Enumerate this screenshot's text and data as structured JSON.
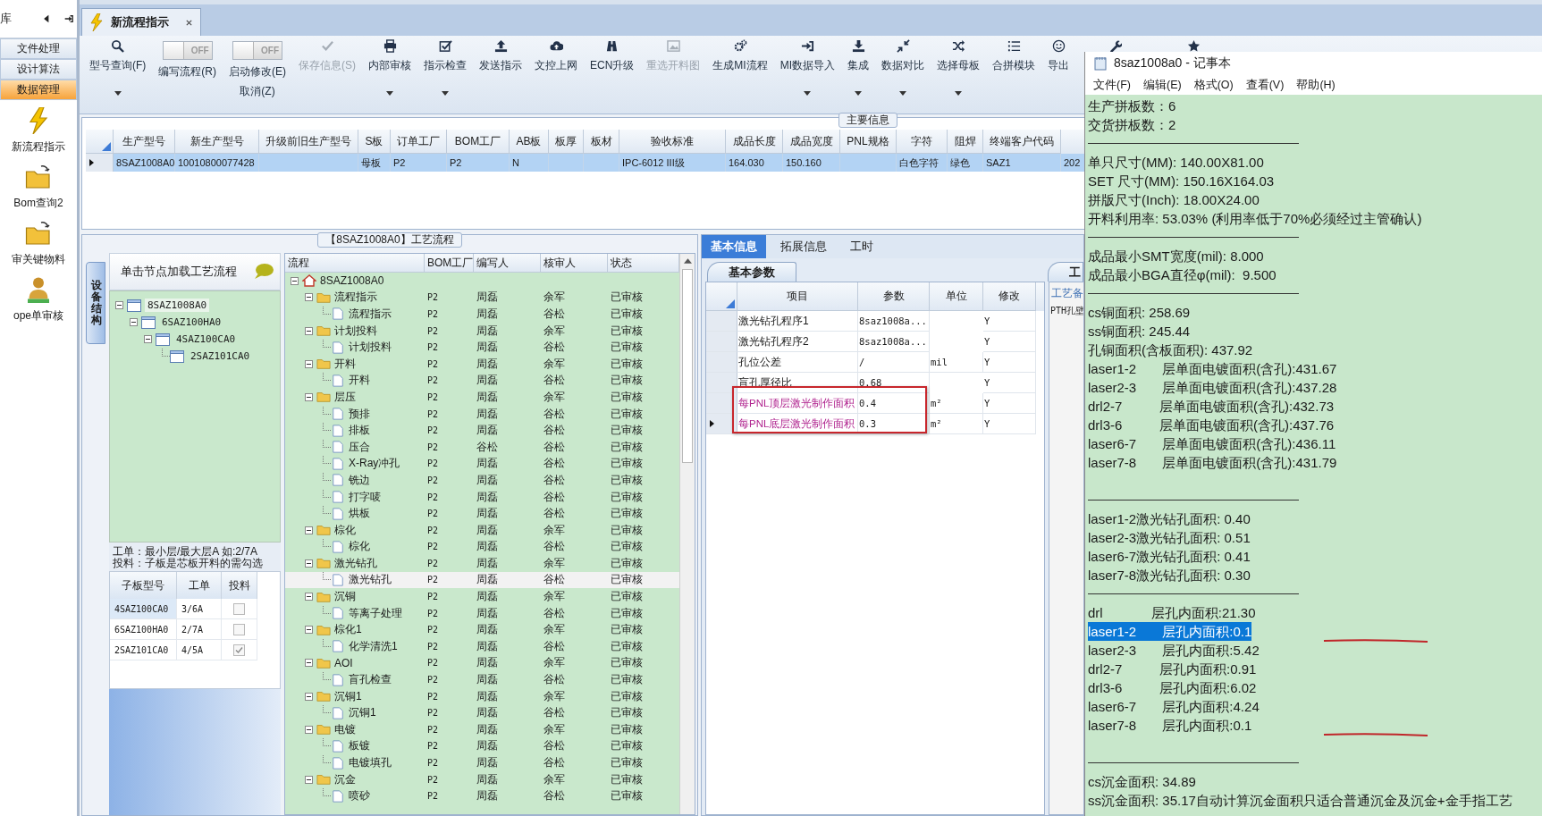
{
  "sidebar": {
    "title": "库",
    "menu": [
      {
        "label": "文件处理",
        "selected": false
      },
      {
        "label": "设计算法",
        "selected": false
      },
      {
        "label": "数据管理",
        "selected": true
      }
    ],
    "shortcuts": [
      {
        "label": "新流程指示"
      },
      {
        "label": "Bom查询2"
      },
      {
        "label": "审关键物料"
      },
      {
        "label": "ope单审核"
      }
    ]
  },
  "tabs": [
    {
      "label": "新流程指示",
      "selected": true,
      "closable": true
    }
  ],
  "toolbar": [
    {
      "kind": "button",
      "label": "型号查询(F)",
      "disabled": false,
      "has_menu": true
    },
    {
      "kind": "toggle",
      "label": "编写流程(R)",
      "switch_text": "OFF",
      "on": false
    },
    {
      "kind": "toggle",
      "label": "启动修改(E)",
      "label2": "取消(Z)",
      "switch_text": "OFF",
      "on": false
    },
    {
      "kind": "button",
      "label": "保存信息(S)",
      "disabled": true,
      "has_menu": false
    },
    {
      "kind": "button",
      "label": "内部审核",
      "disabled": false,
      "has_menu": true
    },
    {
      "kind": "button",
      "label": "指示检查",
      "disabled": false,
      "has_menu": true
    },
    {
      "kind": "button",
      "label": "发送指示",
      "disabled": false,
      "has_menu": false
    },
    {
      "kind": "button",
      "label": "文控上网",
      "disabled": false,
      "has_menu": false
    },
    {
      "kind": "button",
      "label": "ECN升级",
      "disabled": false,
      "has_menu": false
    },
    {
      "kind": "button",
      "label": "重选开料图",
      "disabled": true,
      "has_menu": false
    },
    {
      "kind": "button",
      "label": "生成MI流程",
      "disabled": false,
      "has_menu": false
    },
    {
      "kind": "button",
      "label": "MI数据导入",
      "disabled": false,
      "has_menu": true
    },
    {
      "kind": "button",
      "label": "集成",
      "disabled": false,
      "has_menu": true
    },
    {
      "kind": "button",
      "label": "数据对比",
      "disabled": false,
      "has_menu": true
    },
    {
      "kind": "button",
      "label": "选择母板",
      "disabled": false,
      "has_menu": true
    },
    {
      "kind": "button",
      "label": "合拼模块",
      "disabled": false,
      "has_menu": false
    },
    {
      "kind": "button",
      "label": "导出",
      "disabled": false,
      "has_menu": false
    },
    {
      "kind": "icon"
    },
    {
      "kind": "icon"
    }
  ],
  "main_info": {
    "title": "主要信息",
    "columns": [
      "生产型号",
      "新生产型号",
      "升级前旧生产型号",
      "S板",
      "订单工厂",
      "BOM工厂",
      "AB板",
      "板厚",
      "板材",
      "验收标准",
      "成品长度",
      "成品宽度",
      "PNL规格",
      "字符",
      "阻焊",
      "终端客户代码"
    ],
    "rows": [
      {
        "selected": true,
        "cells": [
          "8SAZ1008A0",
          "10010800077428",
          null,
          "母板",
          "P2",
          "P2",
          "N",
          null,
          null,
          "IPC-6012 III级",
          "164.030",
          "150.160",
          null,
          "白色字符",
          "绿色",
          "SAZ1",
          "202"
        ]
      }
    ]
  },
  "process": {
    "title": "【8SAZ1008A0】工艺流程",
    "side_tab": "设备结构",
    "structure": {
      "hint": "单击节点加载工艺流程",
      "tree": [
        {
          "label": "8SAZ1008A0",
          "expanded": true,
          "children": [
            {
              "label": "6SAZ100HA0",
              "expanded": true,
              "children": [
                {
                  "label": "4SAZ100CA0",
                  "expanded": true,
                  "children": [
                    {
                      "label": "2SAZ101CA0"
                    }
                  ]
                }
              ]
            }
          ]
        }
      ],
      "notes": [
        "工单：最小层/最大层A 如:2/7A",
        "投料：子板是芯板开料的需勾选"
      ],
      "boards": {
        "columns": [
          "子板型号",
          "工单",
          "投料"
        ],
        "rows": [
          {
            "model": "4SAZ100CA0",
            "order": "3/6A",
            "feed": false,
            "selected": true
          },
          {
            "model": "6SAZ100HA0",
            "order": "2/7A",
            "feed": false,
            "selected": false
          },
          {
            "model": "2SAZ101CA0",
            "order": "4/5A",
            "feed": true,
            "selected": false
          }
        ]
      }
    },
    "flow": {
      "columns": [
        "流程",
        "BOM工厂",
        "编写人",
        "核审人",
        "状态"
      ],
      "tree": [
        {
          "name": "8SAZ1008A0",
          "expanded": true,
          "selected": false,
          "children": [
            {
              "name": "流程指示",
              "factory": "P2",
              "writer": "周磊",
              "reviewer": "余军",
              "status": "已审核",
              "expanded": true,
              "selected": false,
              "children": [
                {
                  "name": "流程指示",
                  "factory": "P2",
                  "writer": "周磊",
                  "reviewer": "谷松",
                  "status": "已审核",
                  "selected": false
                }
              ]
            },
            {
              "name": "计划投料",
              "factory": "P2",
              "writer": "周磊",
              "reviewer": "余军",
              "status": "已审核",
              "expanded": true,
              "selected": false,
              "children": [
                {
                  "name": "计划投料",
                  "factory": "P2",
                  "writer": "周磊",
                  "reviewer": "谷松",
                  "status": "已审核",
                  "selected": false
                }
              ]
            },
            {
              "name": "开料",
              "factory": "P2",
              "writer": "周磊",
              "reviewer": "余军",
              "status": "已审核",
              "expanded": true,
              "selected": false,
              "children": [
                {
                  "name": "开料",
                  "factory": "P2",
                  "writer": "周磊",
                  "reviewer": "谷松",
                  "status": "已审核",
                  "selected": false
                }
              ]
            },
            {
              "name": "层压",
              "factory": "P2",
              "writer": "周磊",
              "reviewer": "余军",
              "status": "已审核",
              "expanded": true,
              "selected": false,
              "children": [
                {
                  "name": "预排",
                  "factory": "P2",
                  "writer": "周磊",
                  "reviewer": "谷松",
                  "status": "已审核",
                  "selected": false
                },
                {
                  "name": "排板",
                  "factory": "P2",
                  "writer": "周磊",
                  "reviewer": "谷松",
                  "status": "已审核",
                  "selected": false
                },
                {
                  "name": "压合",
                  "factory": "P2",
                  "writer": "谷松",
                  "reviewer": "谷松",
                  "status": "已审核",
                  "selected": false
                },
                {
                  "name": "X-Ray冲孔",
                  "factory": "P2",
                  "writer": "周磊",
                  "reviewer": "谷松",
                  "status": "已审核",
                  "selected": false
                },
                {
                  "name": "铣边",
                  "factory": "P2",
                  "writer": "周磊",
                  "reviewer": "谷松",
                  "status": "已审核",
                  "selected": false
                },
                {
                  "name": "打字唛",
                  "factory": "P2",
                  "writer": "周磊",
                  "reviewer": "谷松",
                  "status": "已审核",
                  "selected": false
                },
                {
                  "name": "烘板",
                  "factory": "P2",
                  "writer": "周磊",
                  "reviewer": "谷松",
                  "status": "已审核",
                  "selected": false
                }
              ]
            },
            {
              "name": "棕化",
              "factory": "P2",
              "writer": "周磊",
              "reviewer": "余军",
              "status": "已审核",
              "expanded": true,
              "selected": false,
              "children": [
                {
                  "name": "棕化",
                  "factory": "P2",
                  "writer": "周磊",
                  "reviewer": "谷松",
                  "status": "已审核",
                  "selected": false
                }
              ]
            },
            {
              "name": "激光钻孔",
              "factory": "P2",
              "writer": "周磊",
              "reviewer": "余军",
              "status": "已审核",
              "expanded": true,
              "selected": false,
              "children": [
                {
                  "name": "激光钻孔",
                  "factory": "P2",
                  "writer": "周磊",
                  "reviewer": "谷松",
                  "status": "已审核",
                  "selected": true
                }
              ]
            },
            {
              "name": "沉铜",
              "factory": "P2",
              "writer": "周磊",
              "reviewer": "余军",
              "status": "已审核",
              "expanded": true,
              "selected": false,
              "children": [
                {
                  "name": "等离子处理",
                  "factory": "P2",
                  "writer": "周磊",
                  "reviewer": "谷松",
                  "status": "已审核",
                  "selected": false
                }
              ]
            },
            {
              "name": "棕化1",
              "factory": "P2",
              "writer": "周磊",
              "reviewer": "余军",
              "status": "已审核",
              "expanded": true,
              "selected": false,
              "children": [
                {
                  "name": "化学清洗1",
                  "factory": "P2",
                  "writer": "周磊",
                  "reviewer": "谷松",
                  "status": "已审核",
                  "selected": false
                }
              ]
            },
            {
              "name": "AOI",
              "factory": "P2",
              "writer": "周磊",
              "reviewer": "余军",
              "status": "已审核",
              "expanded": true,
              "selected": false,
              "children": [
                {
                  "name": "盲孔检查",
                  "factory": "P2",
                  "writer": "周磊",
                  "reviewer": "谷松",
                  "status": "已审核",
                  "selected": false
                }
              ]
            },
            {
              "name": "沉铜1",
              "factory": "P2",
              "writer": "周磊",
              "reviewer": "余军",
              "status": "已审核",
              "expanded": true,
              "selected": false,
              "children": [
                {
                  "name": "沉铜1",
                  "factory": "P2",
                  "writer": "周磊",
                  "reviewer": "谷松",
                  "status": "已审核",
                  "selected": false
                }
              ]
            },
            {
              "name": "电镀",
              "factory": "P2",
              "writer": "周磊",
              "reviewer": "余军",
              "status": "已审核",
              "expanded": true,
              "selected": false,
              "children": [
                {
                  "name": "板镀",
                  "factory": "P2",
                  "writer": "周磊",
                  "reviewer": "谷松",
                  "status": "已审核",
                  "selected": false
                },
                {
                  "name": "电镀填孔",
                  "factory": "P2",
                  "writer": "周磊",
                  "reviewer": "谷松",
                  "status": "已审核",
                  "selected": false
                }
              ]
            },
            {
              "name": "沉金",
              "factory": "P2",
              "writer": "周磊",
              "reviewer": "余军",
              "status": "已审核",
              "expanded": true,
              "selected": false,
              "children": [
                {
                  "name": "喷砂",
                  "factory": "P2",
                  "writer": "周磊",
                  "reviewer": "谷松",
                  "status": "已审核",
                  "selected": false
                }
              ]
            }
          ]
        }
      ]
    }
  },
  "params": {
    "tabs": [
      {
        "label": "基本信息",
        "selected": true
      },
      {
        "label": "拓展信息",
        "selected": false
      },
      {
        "label": "工时",
        "selected": false
      }
    ],
    "subtab": "基本参数",
    "columns": [
      "项目",
      "参数",
      "单位",
      "修改"
    ],
    "rows": [
      {
        "item": "激光钻孔程序1",
        "value": "8saz1008a...",
        "unit": null,
        "modified": "Y",
        "highlighted": false,
        "current": false
      },
      {
        "item": "激光钻孔程序2",
        "value": "8saz1008a...",
        "unit": null,
        "modified": "Y",
        "highlighted": false,
        "current": false
      },
      {
        "item": "孔位公差",
        "value": "/",
        "unit": "mil",
        "modified": "Y",
        "highlighted": false,
        "current": false
      },
      {
        "item": "盲孔厚径比",
        "value": "0.68",
        "unit": null,
        "modified": "Y",
        "highlighted": false,
        "current": false
      },
      {
        "item": "每PNL顶层激光制作面积",
        "value": "0.4",
        "unit": "m²",
        "modified": "Y",
        "highlighted": true,
        "current": false
      },
      {
        "item": "每PNL底层激光制作面积",
        "value": "0.3",
        "unit": "m²",
        "modified": "Y",
        "highlighted": true,
        "current": true
      }
    ],
    "remarks": {
      "tab": "工",
      "label": "工艺备",
      "text": "PTH孔壁"
    }
  },
  "notepad": {
    "title": "8saz1008a0 - 记事本",
    "menu": [
      "文件(F)",
      "编辑(E)",
      "格式(O)",
      "查看(V)",
      "帮助(H)"
    ],
    "lines": [
      {
        "kind": "text",
        "text": "生产拼板数：6",
        "selected": false,
        "marked": false
      },
      {
        "kind": "text",
        "text": "交货拼板数：2",
        "selected": false,
        "marked": false
      },
      {
        "kind": "rule"
      },
      {
        "kind": "text",
        "text": "单只尺寸(MM): 140.00X81.00",
        "selected": false,
        "marked": false
      },
      {
        "kind": "text",
        "text": "SET 尺寸(MM): 150.16X164.03",
        "selected": false,
        "marked": false
      },
      {
        "kind": "text",
        "text": "拼版尺寸(Inch): 18.00X24.00",
        "selected": false,
        "marked": false
      },
      {
        "kind": "text",
        "text": "开料利用率: 53.03% (利用率低于70%必须经过主管确认)",
        "selected": false,
        "marked": false
      },
      {
        "kind": "rule"
      },
      {
        "kind": "text",
        "text": "成品最小SMT宽度(mil): 8.000",
        "selected": false,
        "marked": false
      },
      {
        "kind": "text",
        "text": "成品最小BGA直径φ(mil):  9.500",
        "selected": false,
        "marked": false
      },
      {
        "kind": "rule"
      },
      {
        "kind": "text",
        "text": "cs铜面积: 258.69",
        "selected": false,
        "marked": false
      },
      {
        "kind": "text",
        "text": "ss铜面积: 245.44",
        "selected": false,
        "marked": false
      },
      {
        "kind": "text",
        "text": "孔铜面积(含板面积): 437.92",
        "selected": false,
        "marked": false
      },
      {
        "kind": "text",
        "text": "laser1-2       层单面电镀面积(含孔):431.67",
        "selected": false,
        "marked": false
      },
      {
        "kind": "text",
        "text": "laser2-3       层单面电镀面积(含孔):437.28",
        "selected": false,
        "marked": false
      },
      {
        "kind": "text",
        "text": "drl2-7          层单面电镀面积(含孔):432.73",
        "selected": false,
        "marked": false
      },
      {
        "kind": "text",
        "text": "drl3-6          层单面电镀面积(含孔):437.76",
        "selected": false,
        "marked": false
      },
      {
        "kind": "text",
        "text": "laser6-7       层单面电镀面积(含孔):436.11",
        "selected": false,
        "marked": false
      },
      {
        "kind": "text",
        "text": "laser7-8       层单面电镀面积(含孔):431.79",
        "selected": false,
        "marked": false
      },
      {
        "kind": "blank"
      },
      {
        "kind": "rule"
      },
      {
        "kind": "text",
        "text": "laser1-2激光钻孔面积: 0.40",
        "selected": false,
        "marked": false
      },
      {
        "kind": "text",
        "text": "laser2-3激光钻孔面积: 0.51",
        "selected": false,
        "marked": false
      },
      {
        "kind": "text",
        "text": "laser6-7激光钻孔面积: 0.41",
        "selected": false,
        "marked": false
      },
      {
        "kind": "text",
        "text": "laser7-8激光钻孔面积: 0.30",
        "selected": false,
        "marked": false
      },
      {
        "kind": "rule"
      },
      {
        "kind": "text",
        "text": "drl             层孔内面积:21.30",
        "selected": false,
        "marked": false
      },
      {
        "kind": "text",
        "text": "laser1-2       层孔内面积:0.1",
        "selected": true,
        "marked": true
      },
      {
        "kind": "text",
        "text": "laser2-3       层孔内面积:5.42",
        "selected": false,
        "marked": false
      },
      {
        "kind": "text",
        "text": "drl2-7          层孔内面积:0.91",
        "selected": false,
        "marked": false
      },
      {
        "kind": "text",
        "text": "drl3-6          层孔内面积:6.02",
        "selected": false,
        "marked": false
      },
      {
        "kind": "text",
        "text": "laser6-7       层孔内面积:4.24",
        "selected": false,
        "marked": false
      },
      {
        "kind": "text",
        "text": "laser7-8       层孔内面积:0.1",
        "selected": false,
        "marked": true
      },
      {
        "kind": "blank"
      },
      {
        "kind": "rule"
      },
      {
        "kind": "text",
        "text": "cs沉金面积: 34.89",
        "selected": false,
        "marked": false
      },
      {
        "kind": "text",
        "text": "ss沉金面积: 35.17自动计算沉金面积只适合普通沉金及沉金+金手指工艺",
        "selected": false,
        "marked": false
      }
    ]
  }
}
